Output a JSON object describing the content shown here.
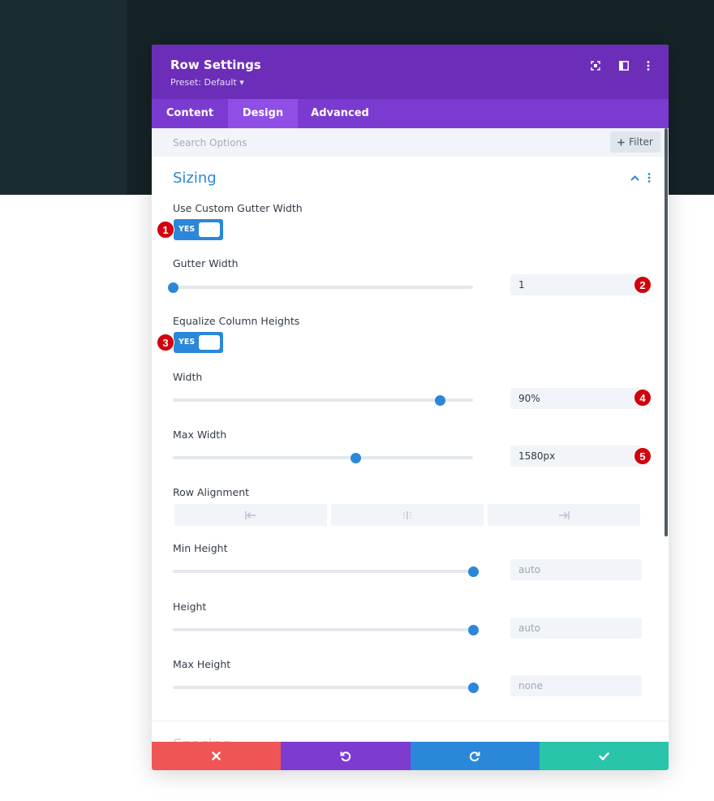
{
  "modal": {
    "title": "Row Settings",
    "preset": "Preset: Default ▾"
  },
  "tabs": [
    {
      "label": "Content",
      "active": false
    },
    {
      "label": "Design",
      "active": true
    },
    {
      "label": "Advanced",
      "active": false
    }
  ],
  "search": {
    "placeholder": "Search Options",
    "filter_label": "Filter"
  },
  "section": {
    "title": "Sizing",
    "next_title": "Spacing"
  },
  "fields": {
    "custom_gutter": {
      "label": "Use Custom Gutter Width",
      "toggle": "YES"
    },
    "gutter_width": {
      "label": "Gutter Width",
      "value": "1"
    },
    "equalize": {
      "label": "Equalize Column Heights",
      "toggle": "YES"
    },
    "width": {
      "label": "Width",
      "value": "90%"
    },
    "max_width": {
      "label": "Max Width",
      "value": "1580px"
    },
    "row_alignment": {
      "label": "Row Alignment"
    },
    "min_height": {
      "label": "Min Height",
      "value": "auto"
    },
    "height": {
      "label": "Height",
      "value": "auto"
    },
    "max_height": {
      "label": "Max Height",
      "value": "none"
    }
  },
  "sliders": {
    "gutter_width": 0.0,
    "width": 0.89,
    "max_width": 0.61,
    "min_height": 1.0,
    "height": 1.0,
    "max_height": 1.0
  },
  "badges": [
    "1",
    "2",
    "3",
    "4",
    "5"
  ],
  "colors": {
    "header": "#6c2eb9",
    "tabs": "#7b3bd1",
    "accent": "#2b87da",
    "badge": "#d0000c",
    "cancel": "#ef5555",
    "undo": "#7e3bd0",
    "redo": "#2b87da",
    "save": "#29c4a9"
  },
  "icons": {
    "header": [
      "focus-icon",
      "columns-icon",
      "more-vertical-icon"
    ],
    "footer": [
      "close-icon",
      "undo-icon",
      "redo-icon",
      "check-icon"
    ]
  }
}
